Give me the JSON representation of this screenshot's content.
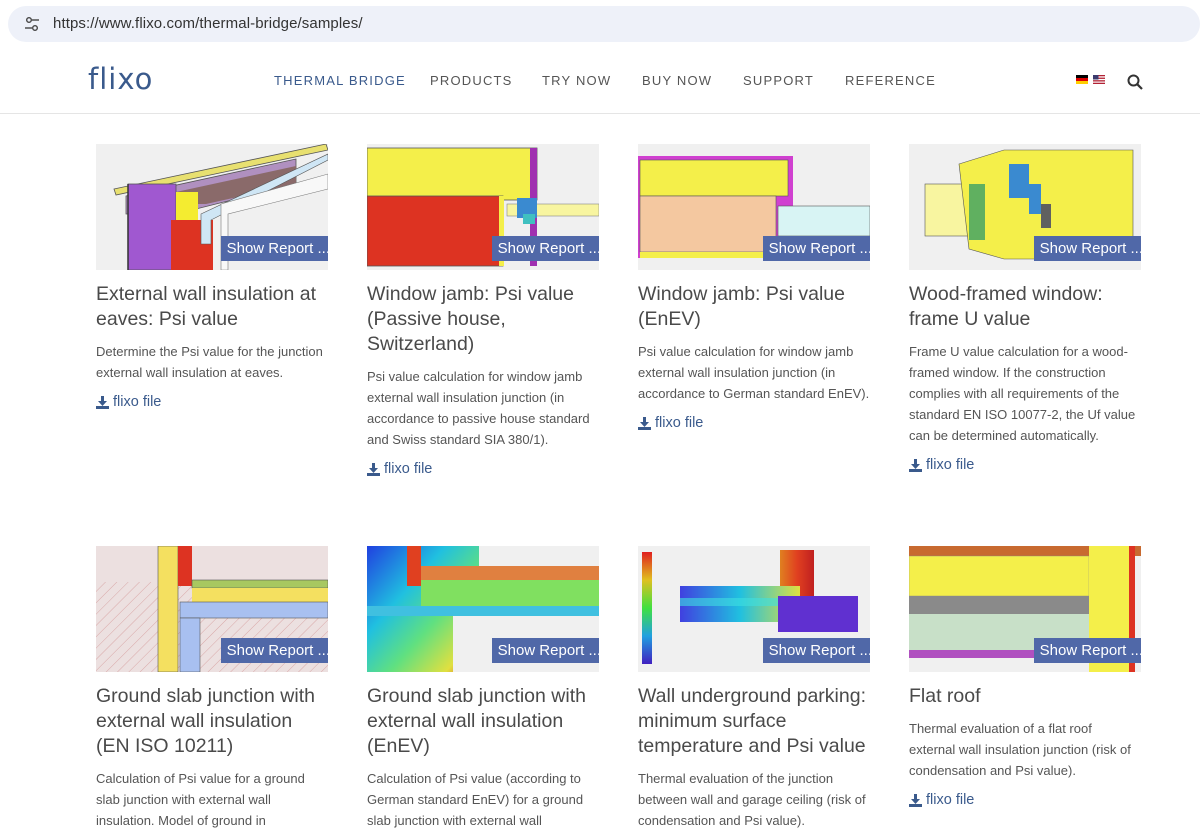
{
  "browser": {
    "url": "https://www.flixo.com/thermal-bridge/samples/"
  },
  "header": {
    "logo": "flixo",
    "nav": [
      {
        "label": "THERMAL BRIDGE",
        "active": true
      },
      {
        "label": "PRODUCTS",
        "active": false
      },
      {
        "label": "TRY NOW",
        "active": false
      },
      {
        "label": "BUY NOW",
        "active": false
      },
      {
        "label": "SUPPORT",
        "active": false
      },
      {
        "label": "REFERENCE",
        "active": false
      }
    ]
  },
  "report_button_label": "Show Report ...",
  "file_link_label": "flixo file",
  "cards": [
    {
      "title": "External wall insulation at eaves: Psi value",
      "description": "Determine the Psi value for the junction external wall insulation at eaves.",
      "button": "Show Report ...",
      "link": "flixo file"
    },
    {
      "title": "Window jamb: Psi value (Passive house, Switzerland)",
      "description": "Psi value calculation for window jamb external wall insulation junction (in accordance to passive house standard and Swiss standard SIA 380/1).",
      "button": "Show Report ...",
      "link": "flixo file"
    },
    {
      "title": "Window jamb: Psi value (EnEV)",
      "description": "Psi value calculation for window jamb external wall insulation junction (in accordance to German standard EnEV).",
      "button": "Show Report ...",
      "link": "flixo file"
    },
    {
      "title": "Wood-framed window: frame U value",
      "description": "Frame U value calculation for a wood-framed window. If the construction complies with all requirements of the standard EN ISO 10077-2, the Uf value can be determined automatically.",
      "button": "Show Report ...",
      "link": "flixo file"
    },
    {
      "title": "Ground slab junction with external wall insulation (EN ISO 10211)",
      "description": "Calculation of Psi value for a ground slab junction with external wall insulation. Model of ground in",
      "button": "Show Report ...",
      "link": ""
    },
    {
      "title": "Ground slab junction with external wall insulation (EnEV)",
      "description": "Calculation of Psi value (according to German standard EnEV) for a ground slab junction with external wall",
      "button": "Show Report ...",
      "link": ""
    },
    {
      "title": "Wall underground parking: minimum surface temperature and Psi value",
      "description": "Thermal evaluation of the junction between wall and garage ceiling (risk of condensation and Psi value).",
      "button": "Show Report ...",
      "link": ""
    },
    {
      "title": "Flat roof",
      "description": "Thermal evaluation of a flat roof external wall insulation junction (risk of condensation and Psi value).",
      "button": "Show Report ...",
      "link": "flixo file"
    }
  ],
  "colors": {
    "brand": "#3a5a8c",
    "button": "#5068a8"
  }
}
